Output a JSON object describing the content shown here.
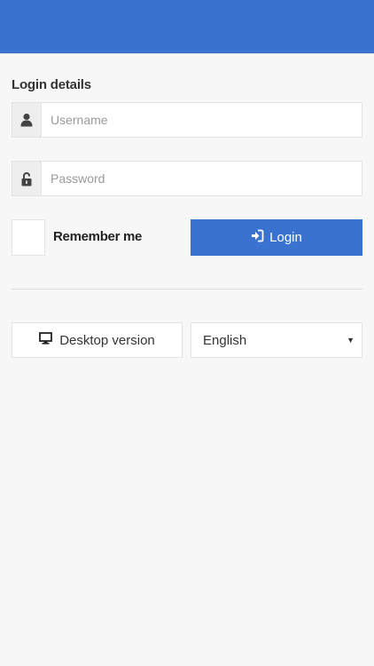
{
  "form": {
    "section_title": "Login details",
    "username": {
      "placeholder": "Username",
      "value": "",
      "icon": "user-icon"
    },
    "password": {
      "placeholder": "Password",
      "value": "",
      "icon": "lock-icon"
    },
    "remember_label": "Remember me",
    "remember_checked": false,
    "login_label": "Login"
  },
  "footer": {
    "desktop_label": "Desktop version",
    "language_selected": "English"
  },
  "colors": {
    "accent": "#3a73cf",
    "background": "#f7f7f7",
    "border": "#e4e4e4"
  }
}
